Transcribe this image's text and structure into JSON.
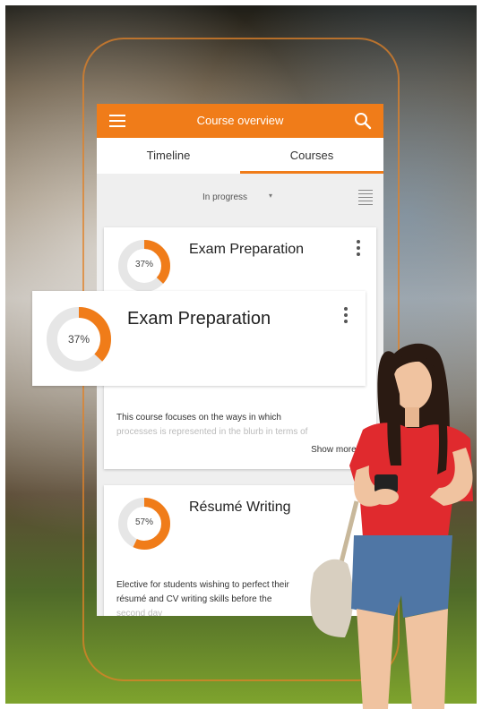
{
  "app": {
    "title": "Course overview",
    "tabs": [
      {
        "label": "Timeline",
        "active": false
      },
      {
        "label": "Courses",
        "active": true
      }
    ],
    "filter": {
      "label": "In progress",
      "caret": "▾"
    }
  },
  "courses": [
    {
      "title": "Exam Preparation",
      "progress_label": "37%",
      "progress": 0.37,
      "description_line1": "This course focuses on the ways in which",
      "description_line2": "processes is represented in the blurb in terms of",
      "show_more": "Show more..."
    },
    {
      "title": "Résumé Writing",
      "progress_label": "57%",
      "progress": 0.57,
      "description_line1": "Elective for students wishing to perfect their",
      "description_line2": "résumé and CV writing skills before the",
      "description_line3": "second day"
    }
  ],
  "popout_card": {
    "title": "Exam Preparation",
    "progress_label": "37%",
    "progress": 0.37
  },
  "colors": {
    "accent": "#f07c19",
    "track": "#e6e6e6",
    "text": "#222222"
  },
  "icons": [
    "menu-icon",
    "search-icon",
    "list-view-icon",
    "more-vert-icon"
  ]
}
